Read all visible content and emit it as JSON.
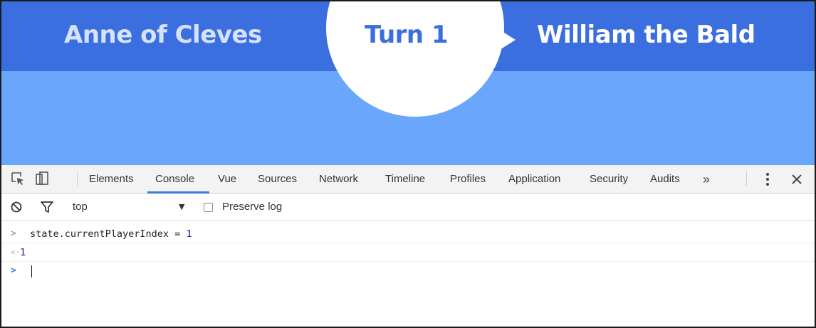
{
  "app": {
    "player_left": "Anne of Cleves",
    "turn_label": "Turn 1",
    "player_right": "William the Bald",
    "colors": {
      "top_bar": "#3b6fe0",
      "sub_band": "#6aa6fb",
      "circle": "#ffffff"
    }
  },
  "devtools": {
    "tabs": [
      "Elements",
      "Console",
      "Vue",
      "Sources",
      "Network",
      "Timeline",
      "Profiles",
      "Application",
      "Security",
      "Audits"
    ],
    "active_tab": "Console",
    "more_tabs_glyph": "»",
    "toolbar": {
      "context": "top",
      "preserve_log_label": "Preserve log",
      "preserve_log_checked": false
    },
    "console": {
      "lines": [
        {
          "prefix": ">",
          "text": "state.currentPlayerIndex = ",
          "value": "1"
        },
        {
          "prefix": "<·",
          "text": "",
          "value": "1"
        },
        {
          "prefix": ">",
          "text": "",
          "value": ""
        }
      ]
    },
    "icons": [
      "inspect-icon",
      "device-toolbar-icon",
      "more-vert-icon",
      "close-icon",
      "clear-console-icon",
      "filter-icon"
    ]
  }
}
